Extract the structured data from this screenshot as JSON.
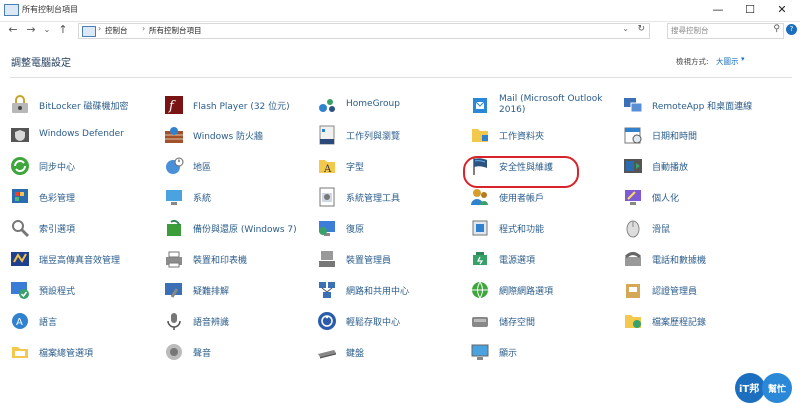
{
  "window": {
    "title": "所有控制台項目",
    "minimize": "—",
    "maximize": "☐",
    "close": "✕"
  },
  "nav": {
    "back": "←",
    "forward": "→",
    "recent": "⌄",
    "up": "↑",
    "breadcrumb": [
      "控制台",
      "所有控制台項目"
    ],
    "search_placeholder": "搜尋控制台"
  },
  "header": {
    "title": "調整電腦設定",
    "view_by_label": "檢視方式:",
    "view_by_value": "大圖示"
  },
  "columns": [
    [
      {
        "label": "BitLocker 磁碟機加密",
        "icon": "bitlocker-icon"
      },
      {
        "label": "Windows Defender",
        "icon": "defender-icon"
      },
      {
        "label": "同步中心",
        "icon": "sync-center-icon"
      },
      {
        "label": "色彩管理",
        "icon": "color-management-icon"
      },
      {
        "label": "索引選項",
        "icon": "indexing-icon"
      },
      {
        "label": "瑞昱高傳真音效管理",
        "icon": "realtek-audio-icon"
      },
      {
        "label": "預設程式",
        "icon": "default-programs-icon"
      },
      {
        "label": "語言",
        "icon": "language-icon"
      },
      {
        "label": "檔案總管選項",
        "icon": "explorer-options-icon"
      }
    ],
    [
      {
        "label": "Flash Player (32 位元)",
        "icon": "flash-icon"
      },
      {
        "label": "Windows 防火牆",
        "icon": "firewall-icon"
      },
      {
        "label": "地區",
        "icon": "region-icon"
      },
      {
        "label": "系統",
        "icon": "system-icon"
      },
      {
        "label": "備份與還原 (Windows 7)",
        "icon": "backup-icon"
      },
      {
        "label": "裝置和印表機",
        "icon": "devices-printers-icon"
      },
      {
        "label": "疑難排解",
        "icon": "troubleshooting-icon"
      },
      {
        "label": "語音辨識",
        "icon": "speech-icon"
      },
      {
        "label": "聲音",
        "icon": "sound-icon"
      }
    ],
    [
      {
        "label": "HomeGroup",
        "icon": "homegroup-icon"
      },
      {
        "label": "工作列與瀏覽",
        "icon": "taskbar-icon"
      },
      {
        "label": "字型",
        "icon": "fonts-icon"
      },
      {
        "label": "系統管理工具",
        "icon": "admin-tools-icon"
      },
      {
        "label": "復原",
        "icon": "recovery-icon"
      },
      {
        "label": "裝置管理員",
        "icon": "device-manager-icon"
      },
      {
        "label": "網路和共用中心",
        "icon": "network-icon"
      },
      {
        "label": "輕鬆存取中心",
        "icon": "ease-of-access-icon"
      },
      {
        "label": "鍵盤",
        "icon": "keyboard-icon"
      }
    ],
    [
      {
        "label": "Mail (Microsoft Outlook 2016)",
        "icon": "mail-icon"
      },
      {
        "label": "工作資料夾",
        "icon": "work-folders-icon"
      },
      {
        "label": "安全性與維護",
        "icon": "security-flag-icon"
      },
      {
        "label": "使用者帳戶",
        "icon": "user-accounts-icon"
      },
      {
        "label": "程式和功能",
        "icon": "programs-icon"
      },
      {
        "label": "電源選項",
        "icon": "power-icon"
      },
      {
        "label": "網際網路選項",
        "icon": "internet-options-icon"
      },
      {
        "label": "儲存空間",
        "icon": "storage-icon"
      },
      {
        "label": "顯示",
        "icon": "display-icon"
      }
    ],
    [
      {
        "label": "RemoteApp 和桌面連線",
        "icon": "remoteapp-icon"
      },
      {
        "label": "日期和時間",
        "icon": "date-time-icon"
      },
      {
        "label": "自動播放",
        "icon": "autoplay-icon"
      },
      {
        "label": "個人化",
        "icon": "personalization-icon"
      },
      {
        "label": "滑鼠",
        "icon": "mouse-icon"
      },
      {
        "label": "電話和數據機",
        "icon": "phone-modem-icon"
      },
      {
        "label": "認證管理員",
        "icon": "credential-icon"
      },
      {
        "label": "檔案歷程記錄",
        "icon": "file-history-icon"
      }
    ]
  ],
  "watermark": {
    "line1": "iT邦",
    "line2": "幫忙"
  },
  "colors": {
    "link": "#2b5d8b",
    "accent": "#1c6fbf",
    "highlight": "#d8232a"
  }
}
